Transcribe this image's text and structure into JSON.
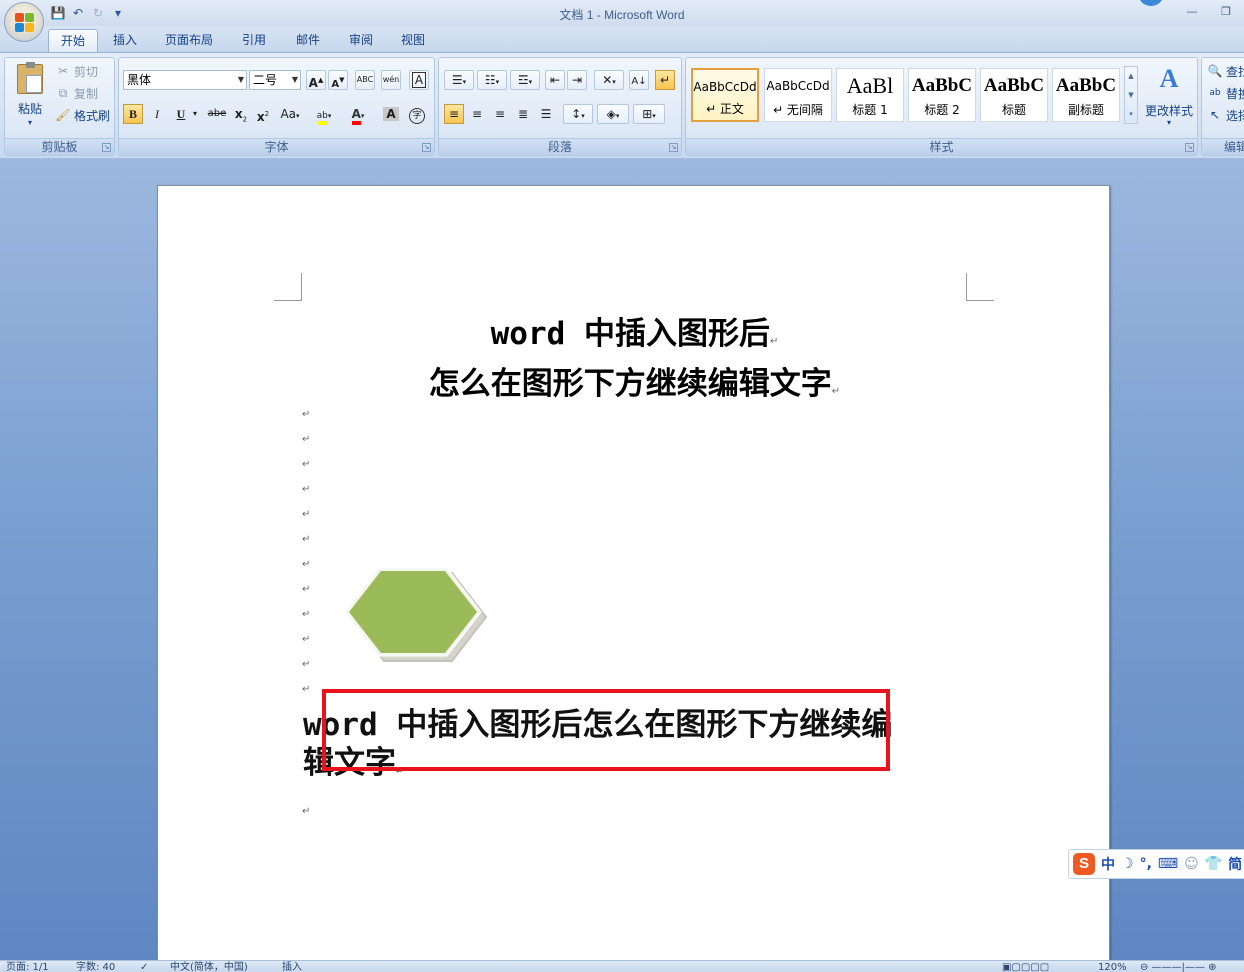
{
  "window": {
    "title": "文档 1 - Microsoft Word",
    "minimize": "—",
    "restore": "❐"
  },
  "qat": {
    "save_icon": "save-icon",
    "undo_icon": "undo-icon",
    "redo_icon": "redo-icon",
    "customize_icon": "customize-icon"
  },
  "tabs": [
    "开始",
    "插入",
    "页面布局",
    "引用",
    "邮件",
    "审阅",
    "视图"
  ],
  "ribbon": {
    "clipboard": {
      "label": "剪贴板",
      "paste": "粘贴",
      "cut": "剪切",
      "copy": "复制",
      "format_painter": "格式刷"
    },
    "font": {
      "label": "字体",
      "font_name": "黑体",
      "font_size": "二号",
      "grow": "A",
      "shrink": "A",
      "clear": "ABC",
      "phonetic": "wén",
      "border_char": "A",
      "bold": "B",
      "italic": "I",
      "underline": "U",
      "strike": "abe",
      "subscript": "x",
      "superscript": "x",
      "change_case": "Aa",
      "highlight": "ab",
      "font_color": "A",
      "shade": "A",
      "enclose": "字"
    },
    "paragraph": {
      "label": "段落"
    },
    "styles": {
      "label": "样式",
      "cards": [
        {
          "sample": "AaBbCcDd",
          "name": "↵ 正文"
        },
        {
          "sample": "AaBbCcDd",
          "name": "↵ 无间隔"
        },
        {
          "sample": "AaBl",
          "name": "标题 1"
        },
        {
          "sample": "AaBbC",
          "name": "标题 2"
        },
        {
          "sample": "AaBbC",
          "name": "标题"
        },
        {
          "sample": "AaBbC",
          "name": "副标题"
        }
      ],
      "change_styles": "更改样式"
    },
    "editing": {
      "label": "编辑",
      "find": "查找",
      "replace": "替换",
      "select": "选择"
    }
  },
  "document": {
    "title_line1": "word 中插入图形后",
    "title_line2": "怎么在图形下方继续编辑文字",
    "para_mark": "↵",
    "body_line1": "word 中插入图形后怎么在图形下方继续编",
    "body_line2": "辑文字",
    "shape": "hexagon",
    "shape_color": "#9bbb59",
    "highlight_color": "#e8131b"
  },
  "ime": {
    "logo": "S",
    "lang": "中",
    "punct": "°,",
    "simplified": "简"
  },
  "statusbar": {
    "page": "页面: 1/1",
    "words": "字数: 40",
    "language": "中文(简体，中国)",
    "mode": "插入",
    "zoom": "120%"
  }
}
